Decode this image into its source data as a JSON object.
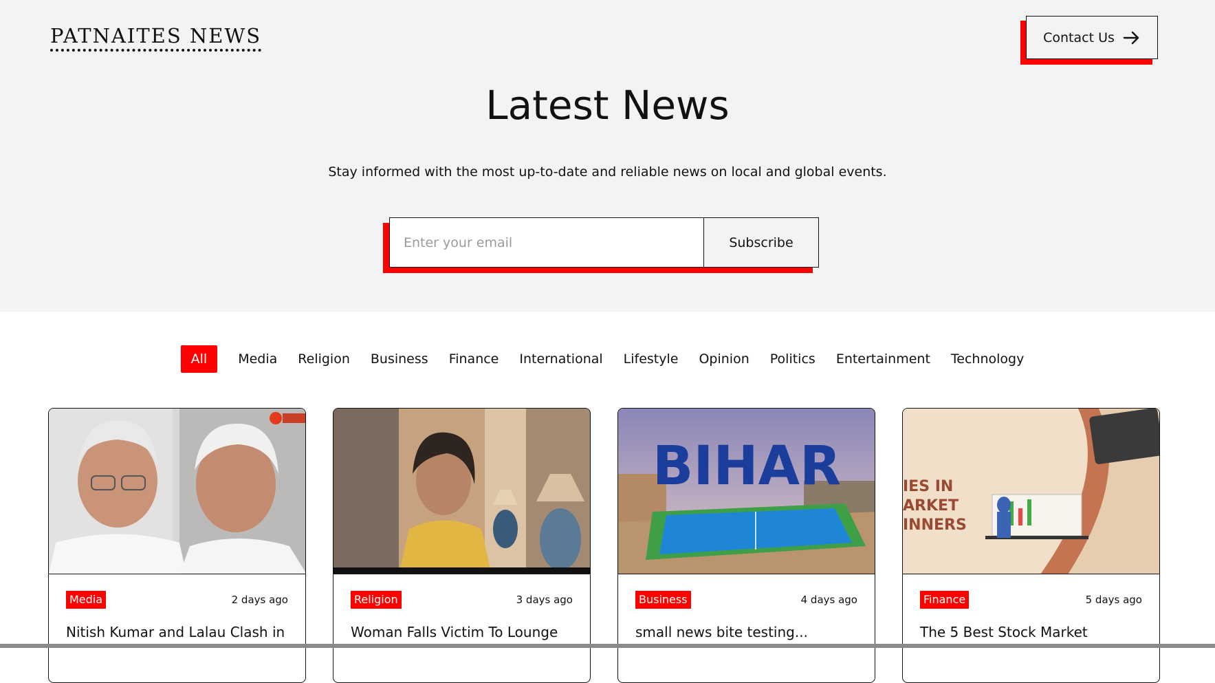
{
  "header": {
    "logo": "PATNAITES NEWS",
    "contact_label": "Contact Us",
    "contact_icon": "arrow-right-icon"
  },
  "hero": {
    "title": "Latest News",
    "subtitle": "Stay informed with the most up-to-date and reliable news on local and global events.",
    "email_placeholder": "Enter your email",
    "subscribe_label": "Subscribe"
  },
  "colors": {
    "accent": "#ff0000",
    "hero_bg": "#f2f3f5",
    "text": "#111111"
  },
  "tabs": [
    {
      "label": "All",
      "active": true
    },
    {
      "label": "Media"
    },
    {
      "label": "Religion"
    },
    {
      "label": "Business"
    },
    {
      "label": "Finance"
    },
    {
      "label": "International"
    },
    {
      "label": "Lifestyle"
    },
    {
      "label": "Opinion"
    },
    {
      "label": "Politics"
    },
    {
      "label": "Entertainment"
    },
    {
      "label": "Technology"
    }
  ],
  "cards": [
    {
      "category": "Media",
      "date": "2 days ago",
      "title": "Nitish Kumar and Lalau Clash in"
    },
    {
      "category": "Religion",
      "date": "3 days ago",
      "title": "Woman Falls Victim To Lounge"
    },
    {
      "category": "Business",
      "date": "4 days ago",
      "title": "small news bite testing...",
      "image_text": "BIHAR"
    },
    {
      "category": "Finance",
      "date": "5 days ago",
      "title": "The 5 Best Stock Market",
      "image_text": "IES IN\nARKET\nINNERS"
    }
  ]
}
